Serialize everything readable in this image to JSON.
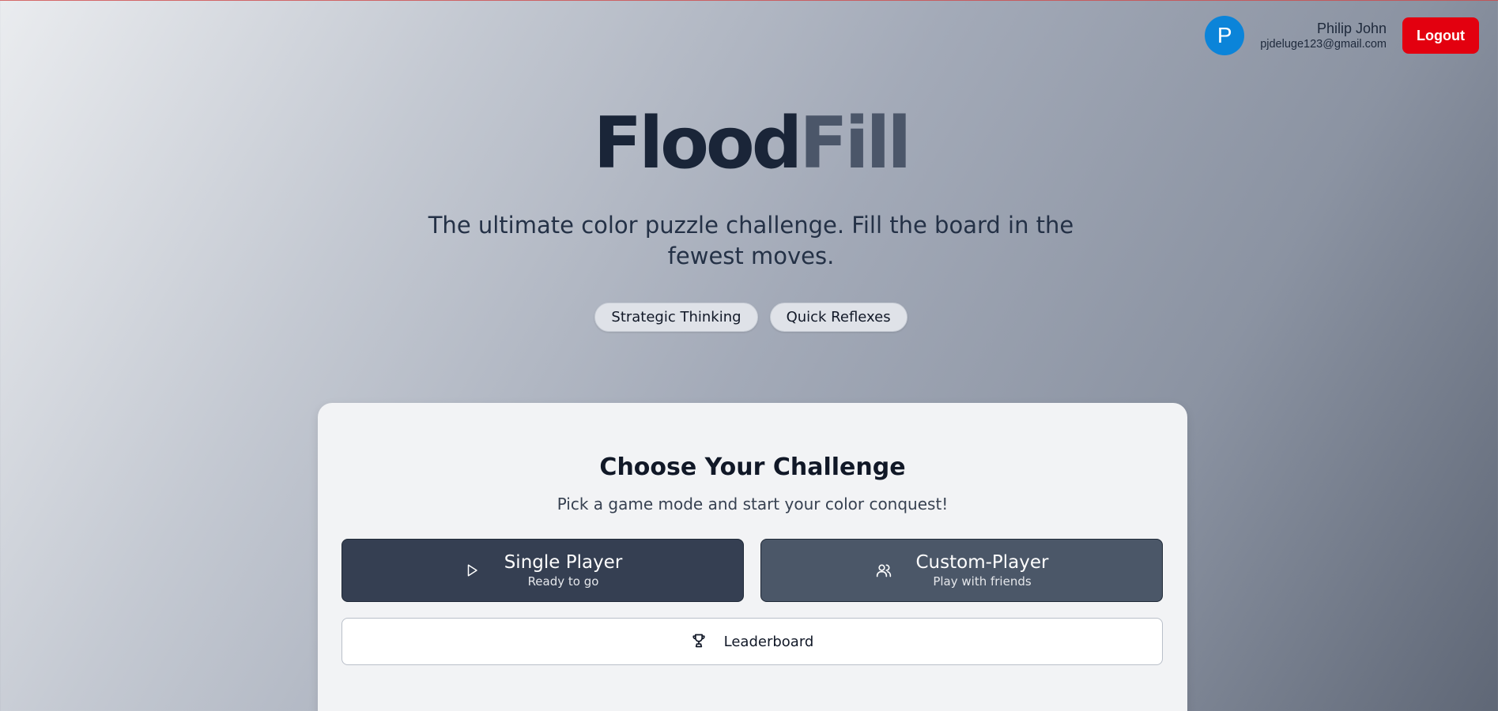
{
  "user": {
    "avatar_initial": "P",
    "name": "Philip John",
    "email": "pjdeluge123@gmail.com",
    "logout_label": "Logout"
  },
  "hero": {
    "title_part1": "Flood",
    "title_part2": "Fill",
    "tagline": "The ultimate color puzzle challenge. Fill the board in the fewest moves.",
    "tags": [
      "Strategic Thinking",
      "Quick Reflexes"
    ]
  },
  "card": {
    "title": "Choose Your Challenge",
    "subtitle": "Pick a game mode and start your color conquest!",
    "modes": [
      {
        "label": "Single Player",
        "description": "Ready to go",
        "icon": "play-icon"
      },
      {
        "label": "Custom-Player",
        "description": "Play with friends",
        "icon": "users-icon"
      }
    ],
    "leaderboard_label": "Leaderboard",
    "leaderboard_icon": "trophy-icon"
  },
  "colors": {
    "logout": "#e3000f",
    "avatar": "#0b84d9",
    "single_player_bg": "#353f52",
    "custom_player_bg": "#4b5768"
  }
}
